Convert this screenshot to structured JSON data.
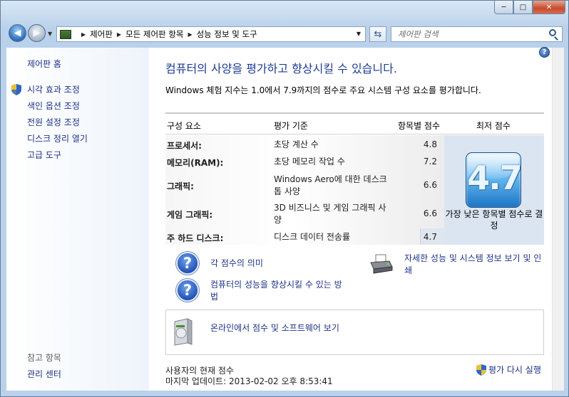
{
  "window": {
    "buttons": {
      "minimize": "─",
      "maximize": "□",
      "close": "✕"
    }
  },
  "address_bar": {
    "breadcrumbs": [
      "제어판",
      "모든 제어판 항목",
      "성능 정보 및 도구"
    ],
    "search_placeholder": "제어판 검색"
  },
  "sidebar": {
    "top_link": "제어판 홈",
    "links": [
      "시각 효과 조정",
      "색인 옵션 조정",
      "전원 설정 조정",
      "디스크 정리 열기",
      "고급 도구"
    ],
    "see_also_heading": "참고 항목",
    "see_also_links": [
      "관리 센터"
    ]
  },
  "main": {
    "heading": "컴퓨터의 사양을 평가하고 향상시킬 수 있습니다.",
    "subtitle": "Windows 체험 지수는 1.0에서 7.9까지의 점수로 주요 시스템 구성 요소를 평가합니다.",
    "table": {
      "headers": [
        "구성 요소",
        "평가 기준",
        "항목별 점수",
        "최저 점수"
      ],
      "rows": [
        {
          "component": "프로세서:",
          "criteria": "초당 계산 수",
          "subscore": "4.8"
        },
        {
          "component": "메모리(RAM):",
          "criteria": "초당 메모리 작업 수",
          "subscore": "7.2"
        },
        {
          "component": "그래픽:",
          "criteria": "Windows Aero에 대한 데스크톱 사양",
          "subscore": "6.6"
        },
        {
          "component": "게임 그래픽:",
          "criteria": "3D 비즈니스 및 게임 그래픽 사양",
          "subscore": "6.6"
        },
        {
          "component": "주 하드 디스크:",
          "criteria": "디스크 데이터 전송률",
          "subscore": "4.7"
        }
      ],
      "base_score": "4.7",
      "base_caption": "가장 낮은 항목별 점수로 결정"
    },
    "links": {
      "score_meaning": "각 점수의 의미",
      "improve_performance": "컴퓨터의 성능을 향상시킬 수 있는 방법",
      "detailed_info": "자세한 성능 및 시스템 정보 보기 및 인쇄",
      "online_software": "온라인에서 점수 및 소프트웨어 보기"
    },
    "footer": {
      "current_score_label": "사용자의 현재 점수",
      "last_update": "마지막 업데이트: 2013-02-02 오후 8:53:41",
      "rerun_label": "평가 다시 실행"
    }
  }
}
